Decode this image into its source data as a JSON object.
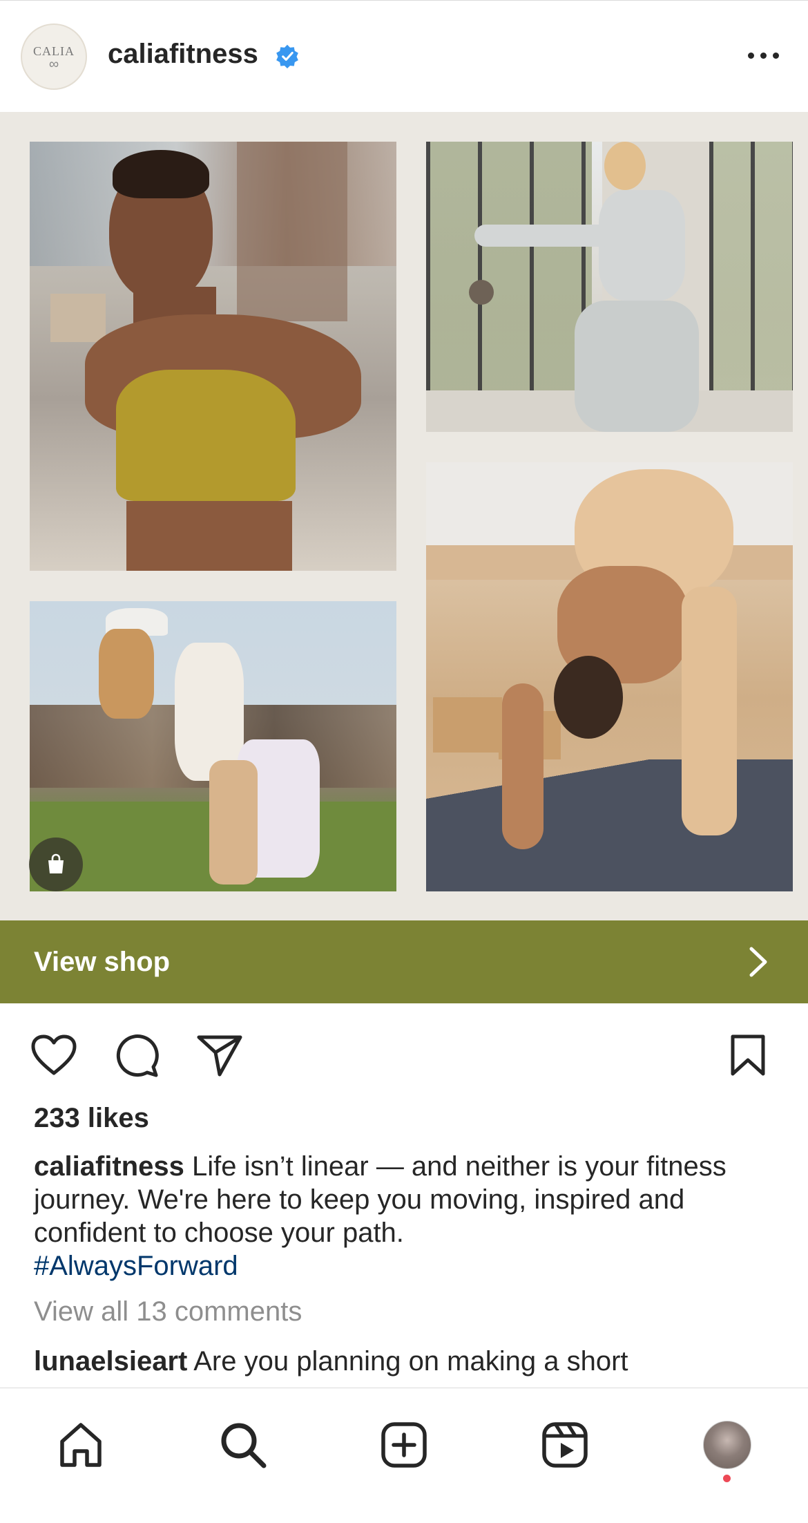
{
  "post": {
    "username": "caliafitness",
    "verified": true,
    "avatar_brand": "CALIA",
    "more_icon": "more-horizontal-icon"
  },
  "collage": {
    "background_color": "#ebe8e2",
    "shop_icon": "shopping-bag-icon"
  },
  "shop_bar": {
    "label": "View shop",
    "color": "#7c8334",
    "icon": "chevron-right-icon"
  },
  "actions": {
    "like_icon": "heart-icon",
    "comment_icon": "comment-icon",
    "share_icon": "send-icon",
    "save_icon": "bookmark-icon"
  },
  "likes_text": "233 likes",
  "caption": {
    "username": "caliafitness",
    "text": "Life isn’t linear — and neither is your fitness journey. We're here to keep you moving, inspired and confident to choose your path.",
    "hashtag": "#AlwaysForward",
    "hashtag_color": "#00376b"
  },
  "view_comments_text": "View all 13 comments",
  "first_comment": {
    "username": "lunaelsieart",
    "text": "Are you planning on making a short"
  },
  "bottom_nav": {
    "items": [
      "home-icon",
      "search-icon",
      "create-icon",
      "reels-icon",
      "profile-avatar"
    ],
    "notification_dot_color": "#ed4956"
  }
}
